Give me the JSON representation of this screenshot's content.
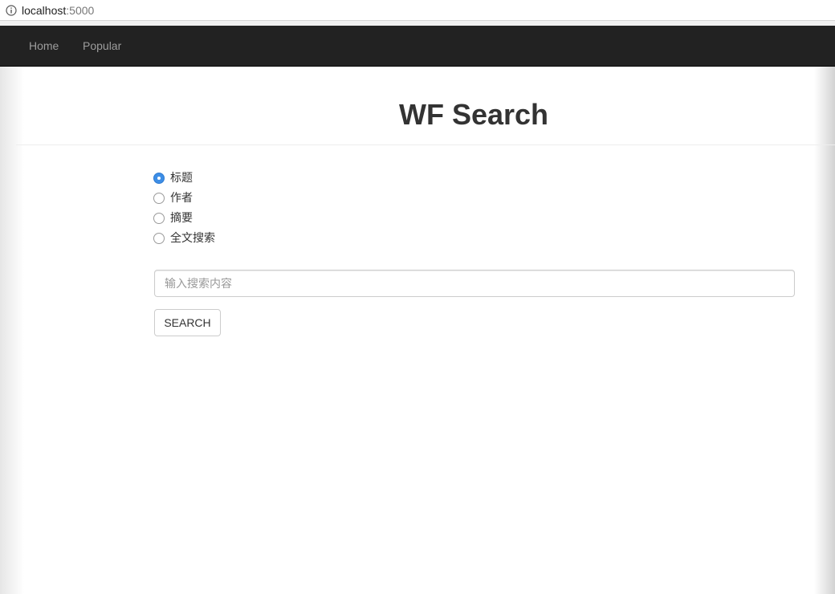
{
  "browser": {
    "url_host": "localhost",
    "url_port": ":5000",
    "info_icon": "info-circle-icon"
  },
  "navbar": {
    "items": [
      {
        "label": "Home"
      },
      {
        "label": "Popular"
      }
    ]
  },
  "main": {
    "title": "WF Search",
    "search_fields": [
      {
        "label": "标题",
        "checked": true
      },
      {
        "label": "作者",
        "checked": false
      },
      {
        "label": "摘要",
        "checked": false
      },
      {
        "label": "全文搜索",
        "checked": false
      }
    ],
    "search_input": {
      "value": "",
      "placeholder": "输入搜索内容"
    },
    "search_button_label": "SEARCH"
  },
  "colors": {
    "navbar_bg": "#222222",
    "nav_link": "#9d9d9d",
    "radio_checked": "#3d8ee6"
  }
}
